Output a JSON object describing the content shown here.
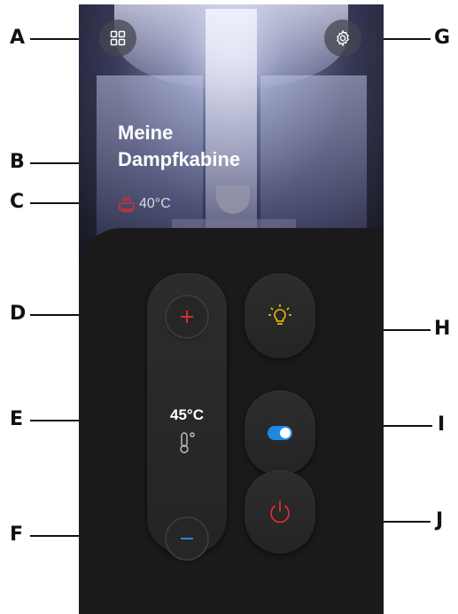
{
  "callouts": {
    "a": "A",
    "b": "B",
    "c": "C",
    "d": "D",
    "e": "E",
    "f": "F",
    "g": "G",
    "h": "H",
    "i": "I",
    "j": "J"
  },
  "cabin": {
    "title_line1": "Meine",
    "title_line2": "Dampfkabine",
    "current_temp": "40°C"
  },
  "control": {
    "setpoint": "45°C"
  },
  "icons": {
    "menu": "grid-icon",
    "settings": "gear-icon",
    "heater": "heater-icon",
    "plus": "plus-icon",
    "minus": "minus-icon",
    "thermometer": "thermometer-icon",
    "light": "lightbulb-icon",
    "toggle": "toggle-icon",
    "power": "power-icon"
  },
  "colors": {
    "plus": "#d32f2f",
    "minus": "#1e88e5",
    "light": "#f2c200",
    "toggle": "#1e88e5",
    "power": "#d32f2f",
    "heater": "#d32f2f"
  }
}
